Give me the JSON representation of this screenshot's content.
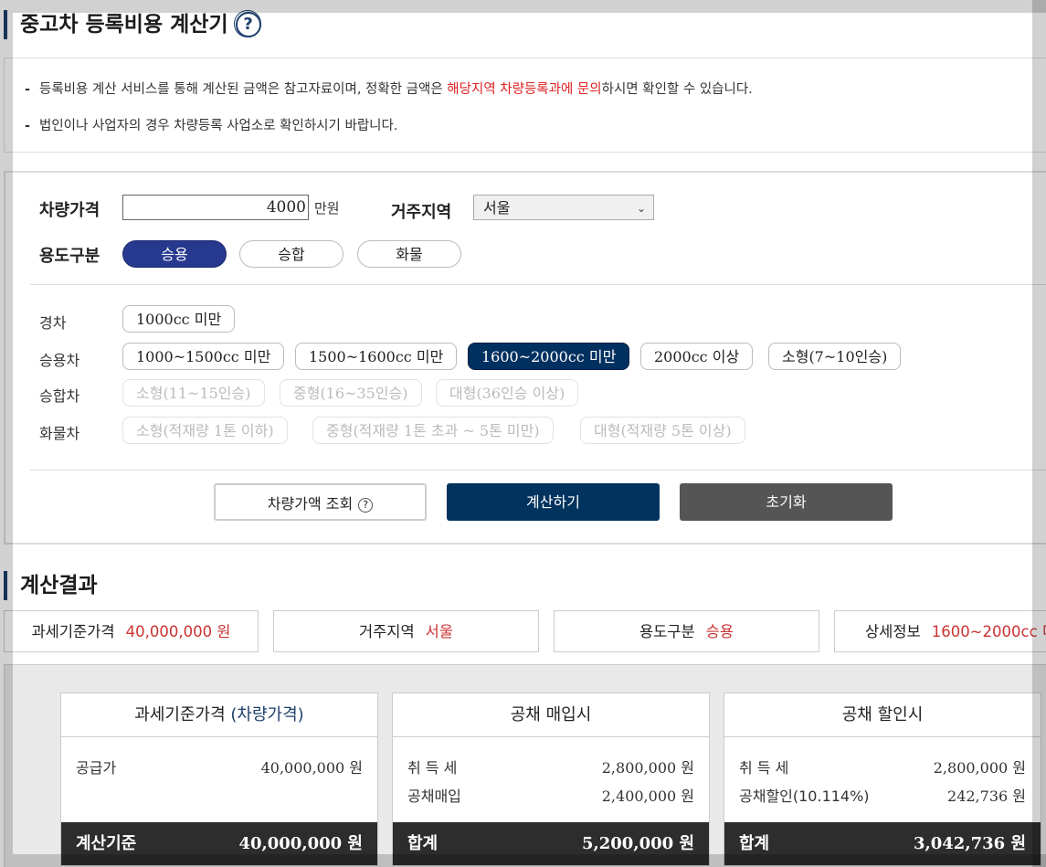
{
  "header": {
    "title": "중고차 등록비용 계산기",
    "help_icon": "?"
  },
  "notice": {
    "line1_pre": "등록비용 계산 서비스를 통해 계산된 금액은 참고자료이며, 정확한 금액은 ",
    "line1_highlight": "해당지역 차량등록과에 문의",
    "line1_post": "하시면 확인할 수 있습니다.",
    "line2": "법인이나 사업자의 경우 차량등록 사업소로 확인하시기 바랍니다."
  },
  "form": {
    "price_label": "차량가격",
    "price_value": "4000",
    "price_unit": "만원",
    "region_label": "거주지역",
    "region_value": "서울",
    "usage_label": "용도구분",
    "usage_options": [
      "승용",
      "승합",
      "화물"
    ],
    "usage_selected": "승용",
    "rows": {
      "light": {
        "label": "경차",
        "options": [
          "1000cc 미만"
        ]
      },
      "passenger": {
        "label": "승용차",
        "options": [
          "1000~1500cc 미만",
          "1500~1600cc 미만",
          "1600~2000cc 미만",
          "2000cc 이상",
          "소형(7~10인승)"
        ],
        "selected": "1600~2000cc 미만"
      },
      "van": {
        "label": "승합차",
        "options": [
          "소형(11~15인승)",
          "중형(16~35인승)",
          "대형(36인승 이상)"
        ]
      },
      "truck": {
        "label": "화물차",
        "options": [
          "소형(적재량 1톤 이하)",
          "중형(적재량 1톤 초과 ~ 5톤 미만)",
          "대형(적재량 5톤 이상)"
        ]
      }
    },
    "buttons": {
      "lookup": "차량가액 조회",
      "lookup_help": "?",
      "calculate": "계산하기",
      "reset": "초기화"
    }
  },
  "result": {
    "title": "계산결과",
    "summary": [
      {
        "key": "과세기준가격",
        "value": "40,000,000 원"
      },
      {
        "key": "거주지역",
        "value": "서울"
      },
      {
        "key": "용도구분",
        "value": "승용"
      },
      {
        "key": "상세정보",
        "value": "1600~2000cc 미"
      }
    ],
    "cards": [
      {
        "title_pre": "과세기준가격 ",
        "title_highlight": "(차량가격)",
        "rows": [
          {
            "label": "공급가",
            "amount": "40,000,000 원"
          }
        ],
        "total_label": "계산기준",
        "total_amount": "40,000,000 원"
      },
      {
        "title_pre": "공채 매입시",
        "title_highlight": "",
        "rows": [
          {
            "label": "취 득 세",
            "amount": "2,800,000 원"
          },
          {
            "label": "공채매입",
            "amount": "2,400,000 원"
          }
        ],
        "total_label": "합계",
        "total_amount": "5,200,000 원"
      },
      {
        "title_pre": "공채 할인시",
        "title_highlight": "",
        "rows": [
          {
            "label": "취 득 세",
            "amount": "2,800,000 원"
          },
          {
            "label": "공채할인(10.114%)",
            "amount": "242,736 원"
          }
        ],
        "total_label": "합계",
        "total_amount": "3,042,736 원"
      }
    ]
  },
  "colors": {
    "accent_navy": "#00335e",
    "usage_active": "#27398f",
    "highlight_red": "#dd2222",
    "footer_dark": "#2d2d2d"
  }
}
